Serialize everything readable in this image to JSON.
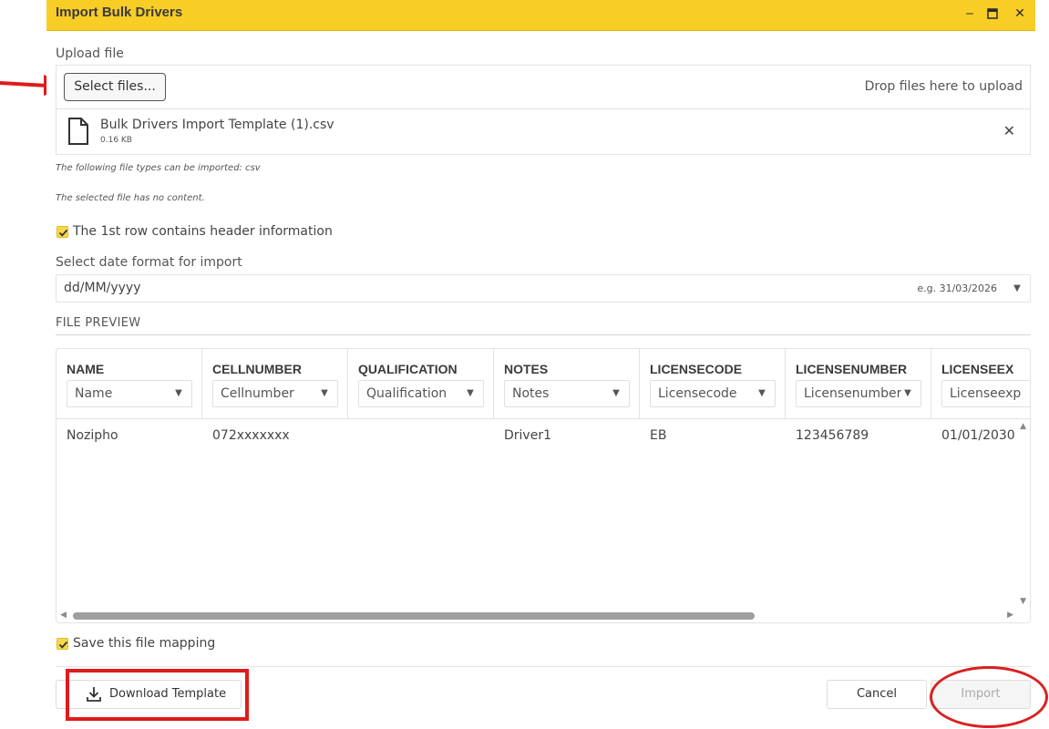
{
  "window": {
    "title": "Import Bulk Drivers",
    "controls": {
      "minimize": "‒",
      "maximize": "□",
      "close": "✕"
    }
  },
  "upload": {
    "label": "Upload file",
    "select_button": "Select files...",
    "drop_hint": "Drop files here to upload",
    "file": {
      "name": "Bulk Drivers Import Template (1).csv",
      "size": "0.16 KB",
      "remove": "✕"
    },
    "allowed_types_note": "The following file types can be imported: csv",
    "content_note": "The selected file has no content."
  },
  "options": {
    "header_row": {
      "label": "The 1st row contains header information",
      "checked": true
    },
    "date_format": {
      "label": "Select date format for import",
      "value": "dd/MM/yyyy",
      "example": "e.g. 31/03/2026"
    },
    "save_mapping": {
      "label": "Save this file mapping",
      "checked": true
    }
  },
  "preview": {
    "title": "FILE PREVIEW",
    "columns": [
      {
        "header": "NAME",
        "mapping": "Name"
      },
      {
        "header": "CELLNUMBER",
        "mapping": "Cellnumber"
      },
      {
        "header": "QUALIFICATION",
        "mapping": "Qualification"
      },
      {
        "header": "NOTES",
        "mapping": "Notes"
      },
      {
        "header": "LICENSECODE",
        "mapping": "Licensecode"
      },
      {
        "header": "LICENSENUMBER",
        "mapping": "Licensenumber"
      },
      {
        "header": "LICENSEEX",
        "mapping": "Licenseexp"
      }
    ],
    "rows": [
      [
        "Nozipho",
        "072xxxxxxx",
        "",
        "Driver1",
        "EB",
        "123456789",
        "01/01/2030"
      ]
    ]
  },
  "footer": {
    "download_template": "Download Template",
    "cancel": "Cancel",
    "import": "Import"
  },
  "colors": {
    "titlebar": "#f8cd26",
    "annotation": "#e01b1b"
  },
  "icons": [
    "minimize-icon",
    "maximize-icon",
    "close-icon",
    "file-icon",
    "remove-file-icon",
    "checkbox-check-icon",
    "dropdown-arrow-icon",
    "download-icon",
    "arrow-annotation"
  ]
}
